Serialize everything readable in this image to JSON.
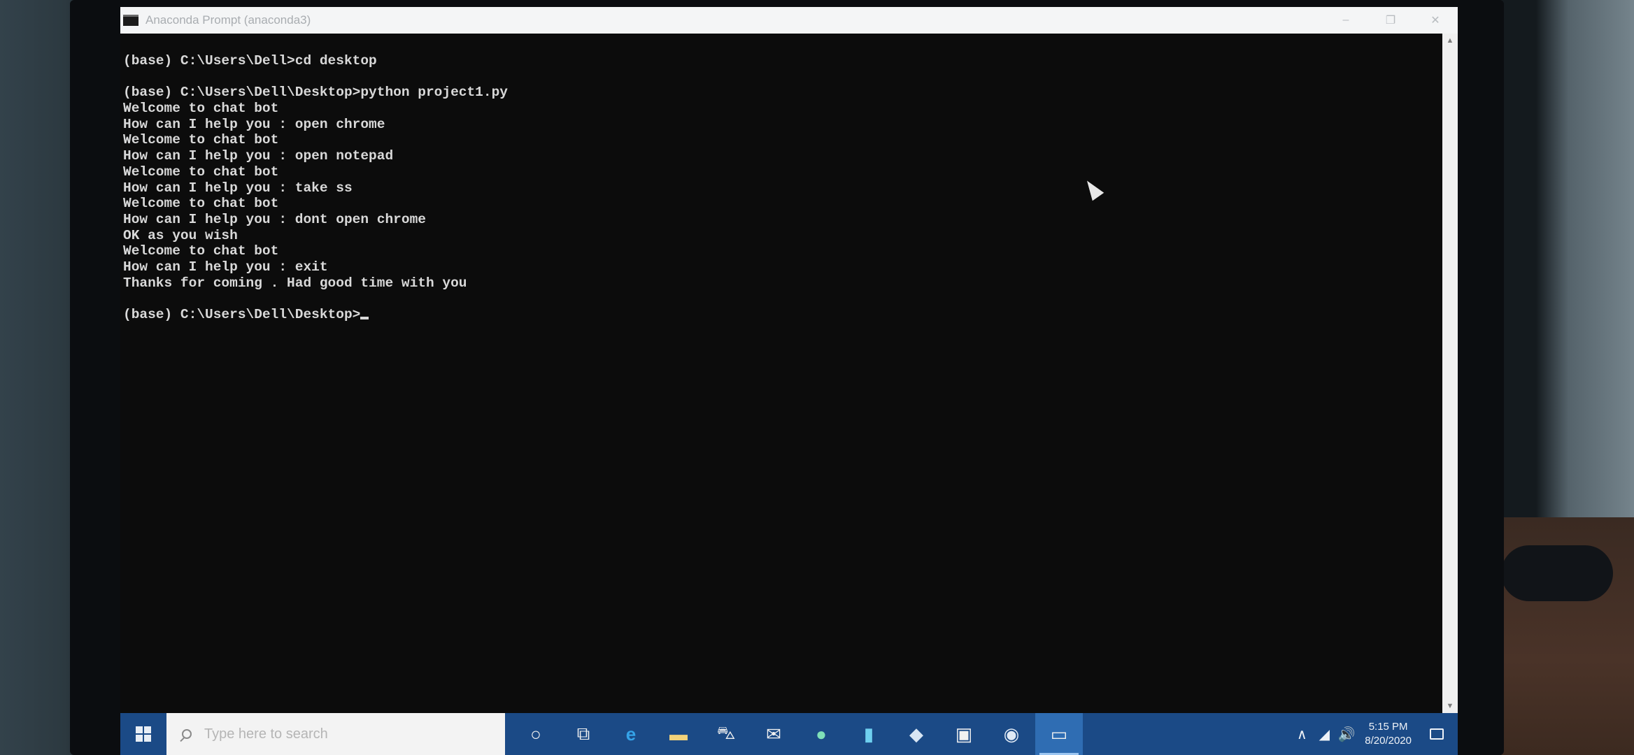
{
  "window": {
    "title": "Anaconda Prompt (anaconda3)",
    "controls": {
      "minimize": "–",
      "maximize": "❐",
      "close": "✕"
    }
  },
  "console": {
    "lines": [
      "(base) C:\\Users\\Dell>cd desktop",
      "",
      "(base) C:\\Users\\Dell\\Desktop>python project1.py",
      "Welcome to chat bot",
      "How can I help you : open chrome",
      "Welcome to chat bot",
      "How can I help you : open notepad",
      "Welcome to chat bot",
      "How can I help you : take ss",
      "Welcome to chat bot",
      "How can I help you : dont open chrome",
      "OK as you wish",
      "Welcome to chat bot",
      "How can I help you : exit",
      "Thanks for coming . Had good time with you",
      "",
      "(base) C:\\Users\\Dell\\Desktop>"
    ]
  },
  "scrollbar": {
    "up_arrow": "▲",
    "down_arrow": "▼"
  },
  "taskbar": {
    "search_placeholder": "Type here to search",
    "icons": [
      {
        "name": "cortana-icon",
        "glyph": "○"
      },
      {
        "name": "task-view-icon",
        "glyph": "⧉"
      },
      {
        "name": "edge-icon",
        "glyph": "e"
      },
      {
        "name": "file-explorer-icon",
        "glyph": "▬"
      },
      {
        "name": "store-icon",
        "glyph": "⛍"
      },
      {
        "name": "mail-icon",
        "glyph": "✉"
      },
      {
        "name": "app-icon-1",
        "glyph": "●"
      },
      {
        "name": "app-icon-2",
        "glyph": "▮"
      },
      {
        "name": "app-icon-3",
        "glyph": "◆"
      },
      {
        "name": "photos-icon",
        "glyph": "▣"
      },
      {
        "name": "chrome-icon",
        "glyph": "◉"
      },
      {
        "name": "anaconda-prompt-icon",
        "glyph": "▭"
      }
    ],
    "tray": {
      "chevron": "∧",
      "network": "◢",
      "volume": "🔊",
      "time": "5:15 PM",
      "date": "8/20/2020"
    }
  },
  "colors": {
    "console_bg": "#0c0c0c",
    "console_text": "#d9d9d9",
    "taskbar": "#1b4a86",
    "titlebar": "#f4f5f6"
  }
}
